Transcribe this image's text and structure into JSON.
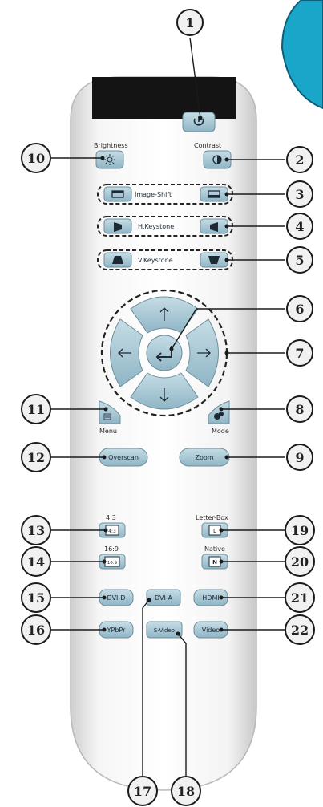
{
  "labels": {
    "brightness": "Brightness",
    "contrast": "Contrast",
    "image_shift": "Image-Shift",
    "h_keystone": "H.Keystone",
    "v_keystone": "V.Keystone",
    "menu": "Menu",
    "mode": "Mode",
    "ratio_43": "4:3",
    "ratio_169": "16:9",
    "letterbox": "Letter-Box",
    "native": "Native"
  },
  "buttons": {
    "overscan": "Overscan",
    "zoom": "Zoom",
    "icon_43": "4:3",
    "icon_169": "16:9",
    "icon_letterbox": "L",
    "icon_native": "N",
    "dvi_d": "DVI-D",
    "dvi_a": "DVI-A",
    "hdmi": "HDMI",
    "ypbpr": "YPbPr",
    "s_video": "S-Video",
    "video": "Video"
  },
  "callouts": {
    "c1": "1",
    "c2": "2",
    "c3": "3",
    "c4": "4",
    "c5": "5",
    "c6": "6",
    "c7": "7",
    "c8": "8",
    "c9": "9",
    "c10": "10",
    "c11": "11",
    "c12": "12",
    "c13": "13",
    "c14": "14",
    "c15": "15",
    "c16": "16",
    "c17": "17",
    "c18": "18",
    "c19": "19",
    "c20": "20",
    "c21": "21",
    "c22": "22"
  },
  "colors": {
    "button": "#a8c9d6",
    "body": "#eeeeee",
    "ir_window": "#141414",
    "corner_accent": "#1aa6c9"
  }
}
